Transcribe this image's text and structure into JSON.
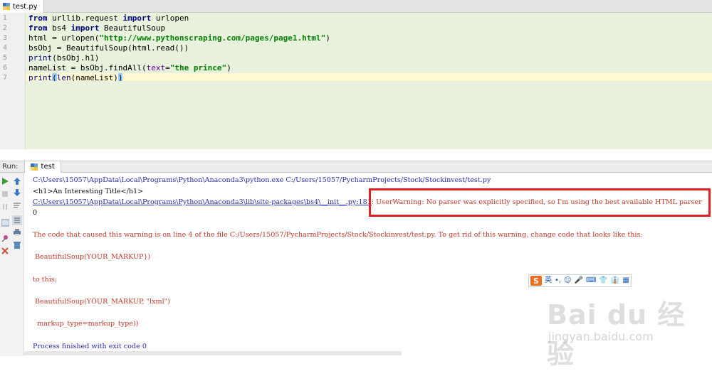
{
  "editor": {
    "tab_label": "test.py",
    "line_numbers": [
      "1",
      "2",
      "3",
      "4",
      "5",
      "6",
      "7"
    ],
    "lines": {
      "l1": {
        "a": "from",
        "b": " urllib.request ",
        "c": "import",
        "d": " urlopen"
      },
      "l2": {
        "a": "from",
        "b": " bs4 ",
        "c": "import",
        "d": " BeautifulSoup"
      },
      "l3": {
        "a": "html = urlopen(",
        "b": "\"http://www.pythonscraping.com/pages/page1.html\"",
        "c": ")"
      },
      "l4": {
        "a": "bsObj = BeautifulSoup(html.read())"
      },
      "l5": {
        "a": "print",
        "b": "(bsObj.h1)"
      },
      "l6": {
        "a": "nameList = bsObj.findAll(",
        "b": "text",
        "c": "=",
        "d": "\"the prince\"",
        "e": ")"
      },
      "l7": {
        "a": "print",
        "b": "(",
        "c": "len",
        "d": "(nameList)",
        "e": ")"
      }
    }
  },
  "run_panel": {
    "label": "Run:",
    "tab_label": "test",
    "output": {
      "cmd": "C:\\Users\\15057\\AppData\\Local\\Programs\\Python\\Anaconda3\\python.exe C:/Users/15057/PycharmProjects/Stock/Stockinvest/test.py",
      "h1": "<h1>An Interesting Title</h1>",
      "warn_link": "C:\\Users\\15057\\AppData\\Local\\Programs\\Python\\Anaconda3\\lib\\site-packages\\bs4\\__init__.py:181",
      "warn_text": ": UserWarning: No parser was explicitly specified, so I'm using the best available HTML parser",
      "zero": "0",
      "code_line": "The code that caused this warning is on line 4 of the file C:/Users/15057/PycharmProjects/Stock/Stockinvest/test.py. To get rid of this warning, change code that looks like this:",
      "markup1": " BeautifulSoup(YOUR_MARKUP})",
      "to_this": "to this:",
      "markup2": " BeautifulSoup(YOUR_MARKUP, \"lxml\")",
      "markup_type": "  markup_type=markup_type))",
      "finished": "Process finished with exit code 0"
    }
  },
  "ime": {
    "logo": "S",
    "items": [
      "英",
      "•,",
      "☺",
      "🎤",
      "⌨",
      "👕",
      "👔",
      "▦"
    ]
  },
  "watermark": {
    "brand": "Bai du 经验",
    "url": "jingyan.baidu.com"
  },
  "colors": {
    "editor_bg": "#e9f2dd",
    "current_line": "#fff8d2",
    "keyword": "#000080",
    "string": "#008000",
    "warning_red": "#c0392b",
    "console_blue": "#2b2baf",
    "highlight_box": "#e02020"
  }
}
